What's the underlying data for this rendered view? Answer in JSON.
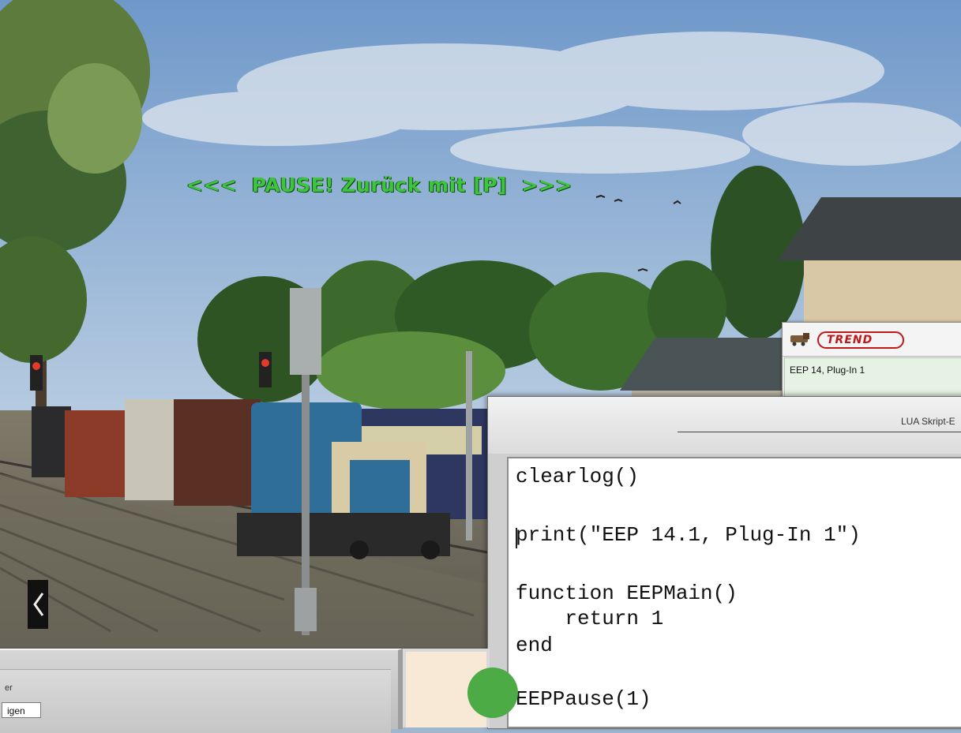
{
  "overlay": {
    "pause_text": "<<<  PAUSE! Zurück mit [P]  >>>"
  },
  "trend_window": {
    "logo_text": "TREND",
    "status_text": "EEP 14, Plug-In 1"
  },
  "lua_window": {
    "title": "LUA Skript-E",
    "code_lines": [
      "clearlog()",
      "print(\"EEP 14.1, Plug-In 1\")",
      "function EEPMain()",
      "    return 1",
      "end",
      "EEPPause(1)"
    ]
  },
  "bottom_window": {
    "label": "er",
    "tab_label": "igen"
  },
  "colors": {
    "overlay_text": "#3ec43e",
    "trend_red": "#c01818",
    "status_green": "#4cab45"
  }
}
